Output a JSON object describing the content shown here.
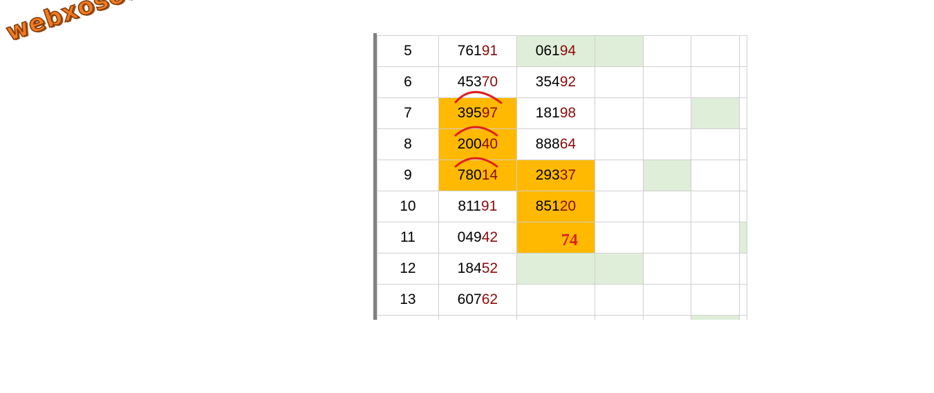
{
  "watermark": {
    "text": "webxoso.net"
  },
  "rows": [
    {
      "index": "5",
      "a_head": "761",
      "a_tail": "91",
      "b_head": "061",
      "b_tail": "94",
      "b_extra": ""
    },
    {
      "index": "6",
      "a_head": "453",
      "a_tail": "70",
      "b_head": "354",
      "b_tail": "92",
      "b_extra": ""
    },
    {
      "index": "7",
      "a_head": "395",
      "a_tail": "97",
      "b_head": "181",
      "b_tail": "98",
      "b_extra": ""
    },
    {
      "index": "8",
      "a_head": "200",
      "a_tail": "40",
      "b_head": "888",
      "b_tail": "64",
      "b_extra": ""
    },
    {
      "index": "9",
      "a_head": "780",
      "a_tail": "14",
      "b_head": "293",
      "b_tail": "37",
      "b_extra": ""
    },
    {
      "index": "10",
      "a_head": "811",
      "a_tail": "91",
      "b_head": "851",
      "b_tail": "20",
      "b_extra": ""
    },
    {
      "index": "11",
      "a_head": "049",
      "a_tail": "42",
      "b_head": "",
      "b_tail": "",
      "b_extra": "74"
    },
    {
      "index": "12",
      "a_head": "184",
      "a_tail": "52",
      "b_head": "",
      "b_tail": "",
      "b_extra": ""
    },
    {
      "index": "13",
      "a_head": "607",
      "a_tail": "62",
      "b_head": "",
      "b_tail": "",
      "b_extra": ""
    }
  ],
  "colors": {
    "highlight": "#ffb900",
    "light_green": "#dfeed9",
    "index_text": "#1010d0",
    "tail_digits": "#8b0a0a",
    "annotation_red": "#e02020",
    "watermark": "#f47a1f"
  }
}
